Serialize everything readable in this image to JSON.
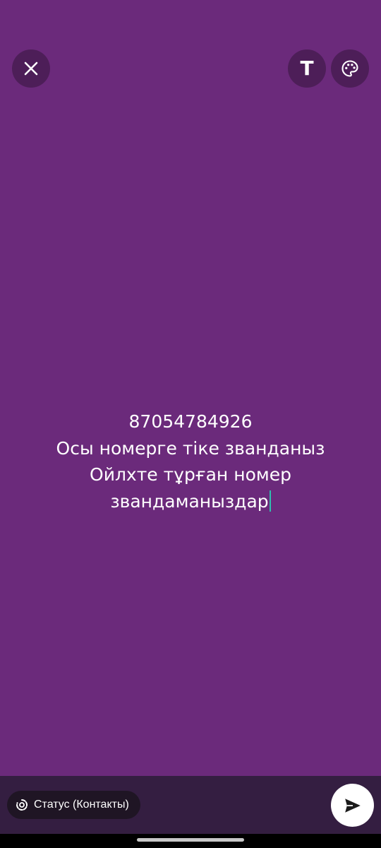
{
  "status_editor": {
    "background_color": "#6b2a7b",
    "text": "87054784926\nОсы номерге тіке званданыз\nОйлхте тұрған номер\nзвандаманыздар",
    "toolbar": {
      "close_icon": "close-icon",
      "font_icon": "text-font-icon",
      "font_label": "T",
      "color_icon": "palette-icon"
    }
  },
  "bottom_bar": {
    "audience_label": "Статус (Контакты)",
    "audience_icon": "status-icon",
    "send_icon": "send-icon"
  }
}
